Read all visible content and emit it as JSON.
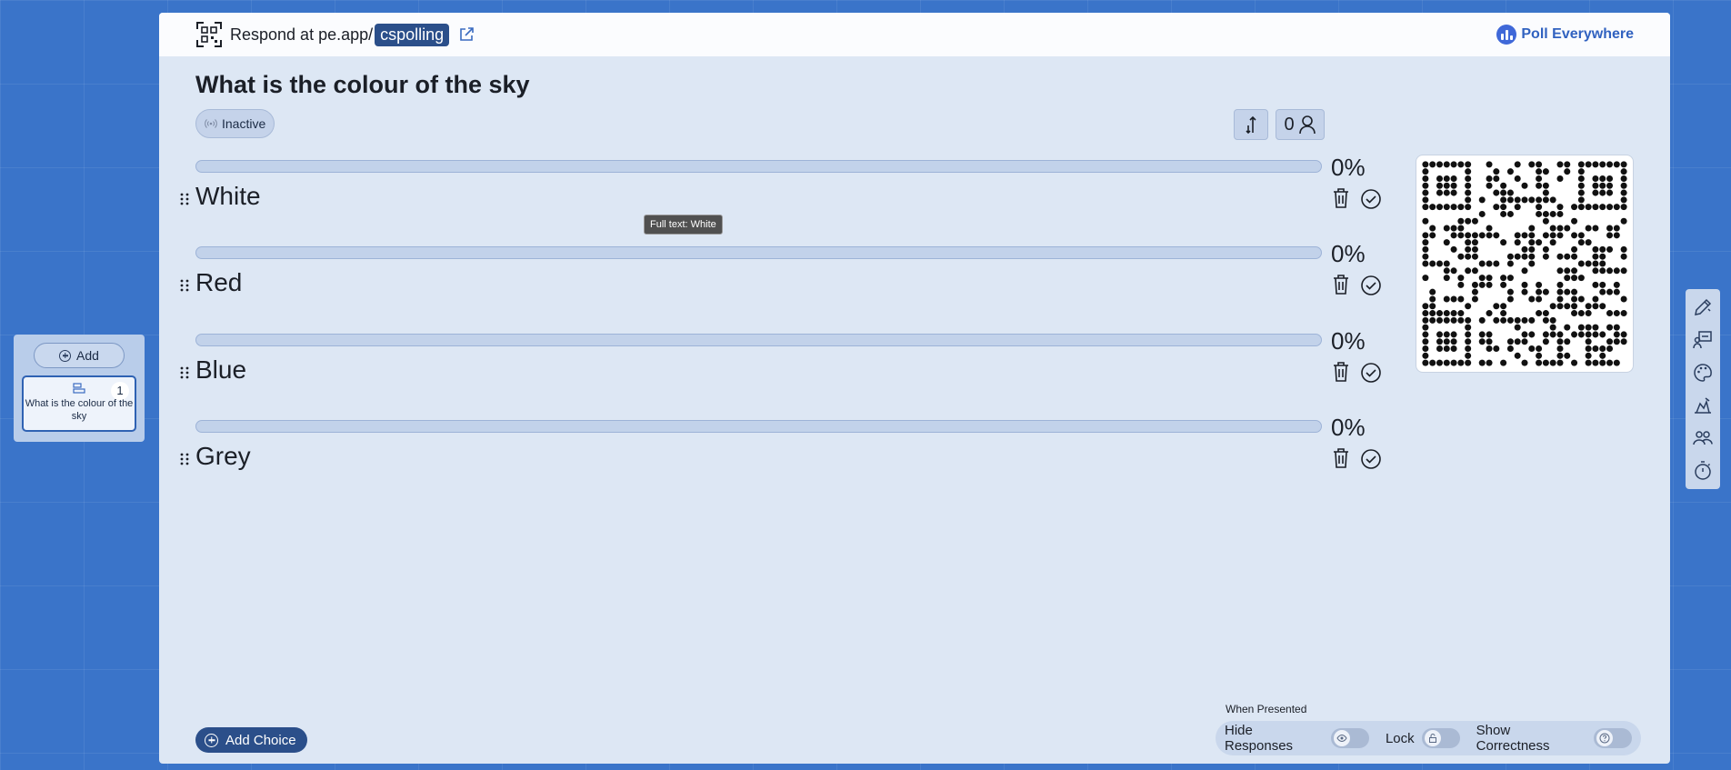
{
  "sidebar": {
    "add_label": "Add",
    "slides": [
      {
        "number": "1",
        "title": "What is the colour of the sky"
      }
    ]
  },
  "header": {
    "respond_prefix": "Respond at pe.app/",
    "respond_code": "cspolling",
    "brand_name": "Poll Everywhere"
  },
  "question": {
    "title": "What is the colour of the sky",
    "status": "Inactive",
    "response_count": "0"
  },
  "choices": [
    {
      "label": "White",
      "percent": "0%",
      "fraction": 0
    },
    {
      "label": "Red",
      "percent": "0%",
      "fraction": 0
    },
    {
      "label": "Blue",
      "percent": "0%",
      "fraction": 0
    },
    {
      "label": "Grey",
      "percent": "0%",
      "fraction": 0
    }
  ],
  "tooltip": "Full text: White",
  "footer": {
    "add_choice_label": "Add Choice",
    "when_presented_label": "When Presented",
    "toggles": [
      {
        "label": "Hide Responses",
        "icon": "eye-icon",
        "on": false
      },
      {
        "label": "Lock",
        "icon": "lock-icon",
        "on": false
      },
      {
        "label": "Show Correctness",
        "icon": "question-icon",
        "on": false
      }
    ]
  },
  "tool_rail": [
    "edit-pen-icon",
    "presenter-icon",
    "palette-icon",
    "visual-settings-icon",
    "audience-icon",
    "timer-icon"
  ],
  "colors": {
    "accent": "#2b4f8a",
    "background": "#3a74c9",
    "canvas": "#dde7f4",
    "brand": "#3162c0"
  }
}
